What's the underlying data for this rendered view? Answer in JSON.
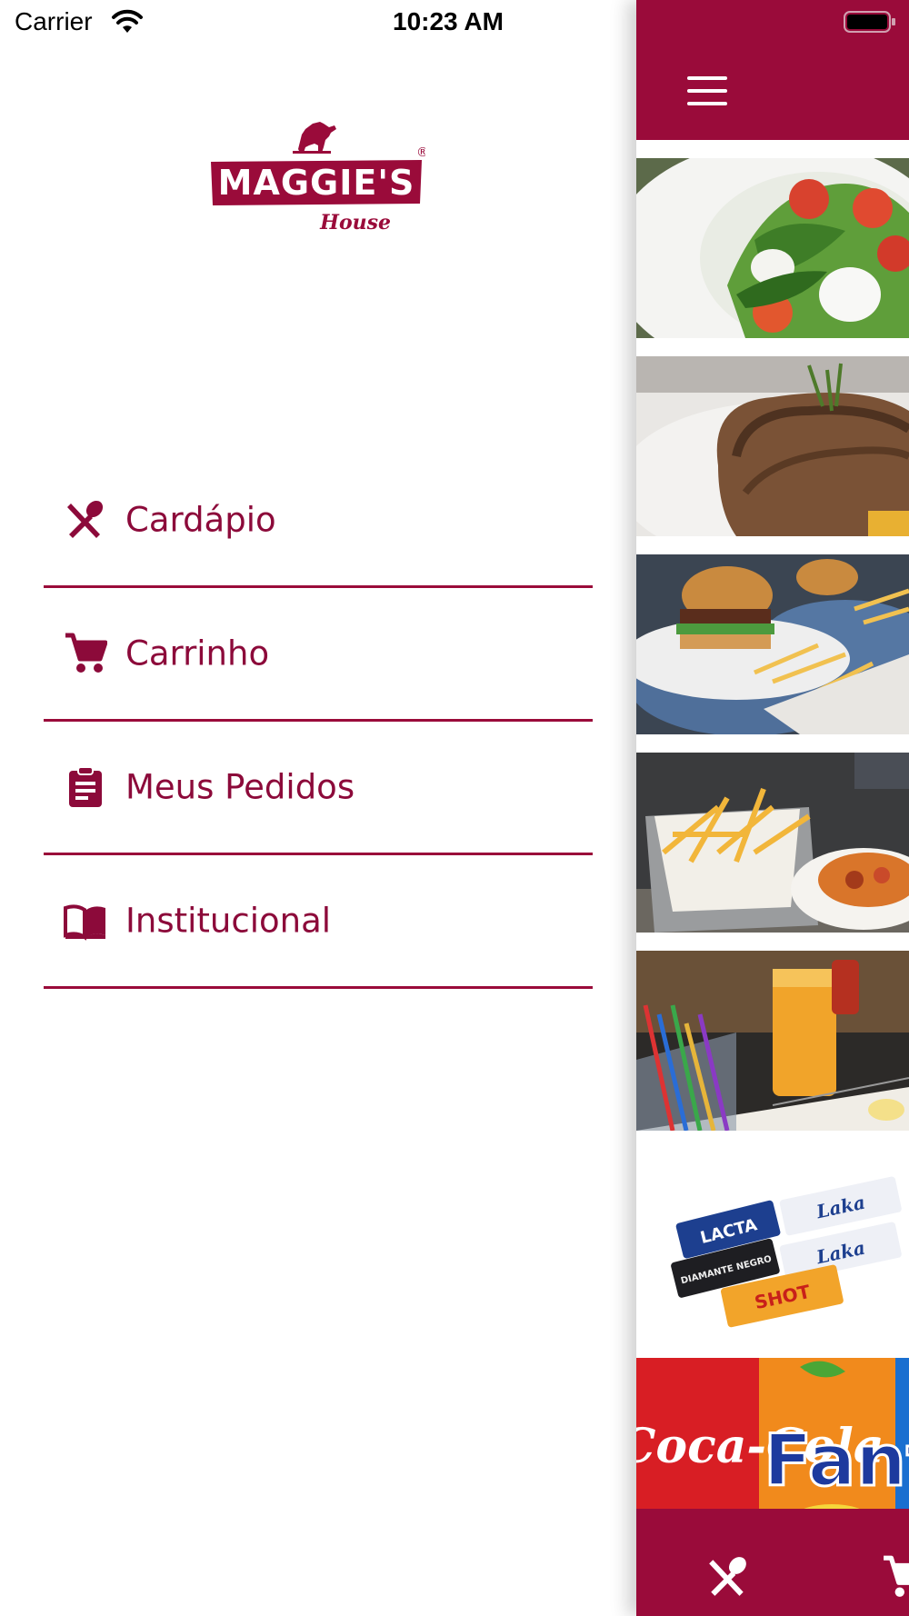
{
  "status_bar": {
    "carrier": "Carrier",
    "time": "10:23 AM"
  },
  "brand": {
    "logo_text": "MAGGIE'S",
    "logo_subtext": "House",
    "registered_mark": "®",
    "primary_color": "#9a0b3a"
  },
  "menu": {
    "items": [
      {
        "label": "Cardápio",
        "icon": "fork-knife-icon"
      },
      {
        "label": "Carrinho",
        "icon": "cart-icon"
      },
      {
        "label": "Meus Pedidos",
        "icon": "clipboard-icon"
      },
      {
        "label": "Institucional",
        "icon": "book-icon"
      }
    ]
  },
  "main": {
    "header_icon": "hamburger-icon",
    "tiles": [
      {
        "name": "salad"
      },
      {
        "name": "steak"
      },
      {
        "name": "burgers"
      },
      {
        "name": "fries-basket"
      },
      {
        "name": "juice"
      },
      {
        "name": "chocolates",
        "labels": [
          "LACTA",
          "Laka",
          "DIAMANTE NEGRO",
          "SHOT"
        ]
      },
      {
        "name": "sodas",
        "labels": [
          "Coca-Cola",
          "Fanta"
        ]
      }
    ],
    "bottom_tabs": [
      "fork-knife-icon",
      "cart-icon"
    ]
  }
}
